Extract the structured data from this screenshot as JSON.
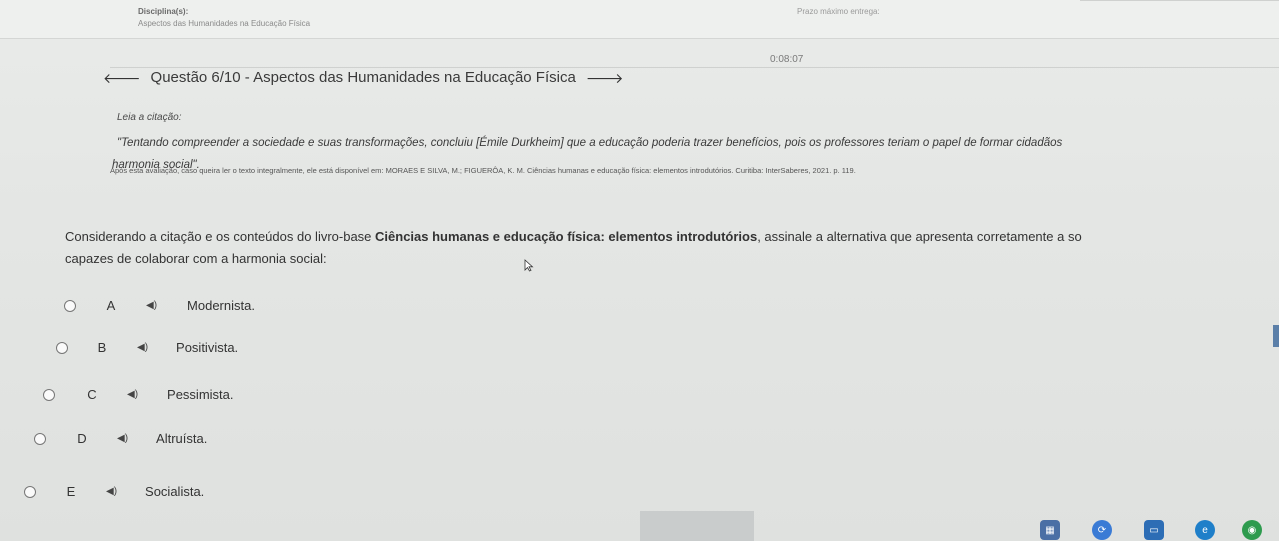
{
  "header": {
    "discipline_label": "Disciplina(s):",
    "discipline_value": "Aspectos das Humanidades na Educação Física",
    "deadline_label": "Prazo máximo entrega:"
  },
  "timer": "0:08:07",
  "question": {
    "prev_icon": "arrow-left-icon",
    "next_icon": "arrow-right-icon",
    "title": "Questão 6/10 - Aspectos das Humanidades na Educação Física"
  },
  "citation": {
    "read_label": "Leia a citação:",
    "quote_line1": "\"Tentando compreender a sociedade e suas transformações, concluiu [Émile Durkheim] que a educação poderia trazer benefícios, pois os professores teriam o papel de formar cidadãos",
    "quote_line2": "harmonia social\".",
    "reference": "Após esta avaliação, caso queira ler o texto integralmente, ele está disponível em: MORAES E SILVA, M.; FIGUERÔA, K. M. Ciências humanas e educação física: elementos introdutórios. Curitiba: InterSaberes, 2021. p. 119.",
    "reference_bold": "Após esta avaliação,"
  },
  "prompt": {
    "line1_pre": "Considerando a citação e os conteúdos do livro-base ",
    "line1_bold": "Ciências humanas e educação física: elementos introdutórios",
    "line1_post": ", assinale a alternativa que apresenta corretamente a so",
    "line2": "capazes de colaborar com a harmonia social:"
  },
  "options": [
    {
      "letter": "A",
      "text": "Modernista.",
      "icon": "speaker-icon"
    },
    {
      "letter": "B",
      "text": "Positivista.",
      "icon": "speaker-icon"
    },
    {
      "letter": "C",
      "text": "Pessimista.",
      "icon": "speaker-icon"
    },
    {
      "letter": "D",
      "text": "Altruísta.",
      "icon": "speaker-icon"
    },
    {
      "letter": "E",
      "text": "Socialista.",
      "icon": "speaker-icon"
    }
  ],
  "taskbar": {
    "icons": [
      "app-icon",
      "sync-icon",
      "store-icon",
      "edge-icon",
      "chrome-icon"
    ],
    "colors": [
      "#4a6fa5",
      "#3a7bd5",
      "#2d6db5",
      "#1f7fc9",
      "#2e9b4e"
    ]
  }
}
